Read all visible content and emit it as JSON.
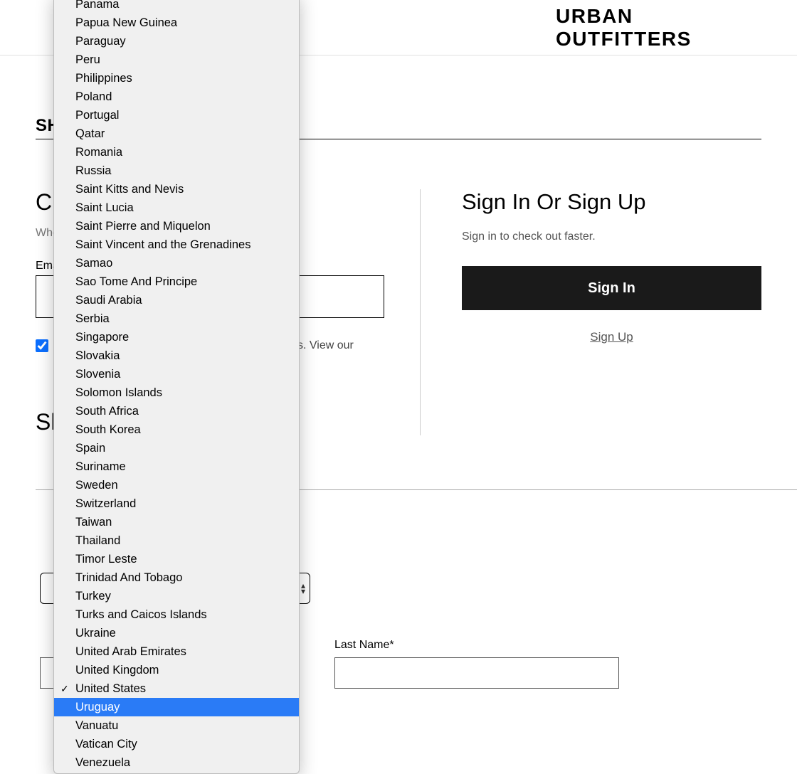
{
  "header": {
    "brand": "URBAN OUTFITTERS"
  },
  "sectionTitlePartial": "SH",
  "checkout": {
    "headingPartial": "Ch",
    "subPartial": "Whe",
    "emailLabelPartial": "Ema"
  },
  "consentPartial": "s. View our",
  "shippingHeadingPartial": "Sh",
  "signin": {
    "heading": "Sign In Or Sign Up",
    "sub": "Sign in to check out faster.",
    "button": "Sign In",
    "signup": "Sign Up"
  },
  "lastNameLabel": "Last Name*",
  "dropdown": {
    "selected": "United States",
    "highlighted": "Uruguay",
    "items": [
      "Panama",
      "Papua New Guinea",
      "Paraguay",
      "Peru",
      "Philippines",
      "Poland",
      "Portugal",
      "Qatar",
      "Romania",
      "Russia",
      "Saint Kitts and Nevis",
      "Saint Lucia",
      "Saint Pierre and Miquelon",
      "Saint Vincent and the Grenadines",
      "Samao",
      "Sao Tome And Principe",
      "Saudi Arabia",
      "Serbia",
      "Singapore",
      "Slovakia",
      "Slovenia",
      "Solomon Islands",
      "South Africa",
      "South Korea",
      "Spain",
      "Suriname",
      "Sweden",
      "Switzerland",
      "Taiwan",
      "Thailand",
      "Timor Leste",
      "Trinidad And Tobago",
      "Turkey",
      "Turks and Caicos Islands",
      "Ukraine",
      "United Arab Emirates",
      "United Kingdom",
      "United States",
      "Uruguay",
      "Vanuatu",
      "Vatican City",
      "Venezuela"
    ]
  }
}
